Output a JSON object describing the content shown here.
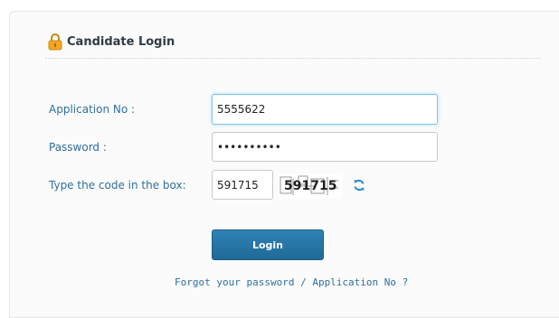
{
  "panel": {
    "title": "Candidate Login",
    "lock_icon": "lock-icon"
  },
  "form": {
    "application_no": {
      "label": "Application No :",
      "value": "5555622"
    },
    "password": {
      "label": "Password :",
      "value": "••••••••••"
    },
    "captcha": {
      "label": "Type the code in the box:",
      "value": "591715",
      "code": "591715",
      "refresh_icon": "refresh-icon"
    },
    "login_label": "Login",
    "forgot_link": "Forgot your password / Application No ?"
  },
  "colors": {
    "label": "#2d6f9e",
    "button": "#2874a6",
    "lock": "#f0a01e"
  }
}
